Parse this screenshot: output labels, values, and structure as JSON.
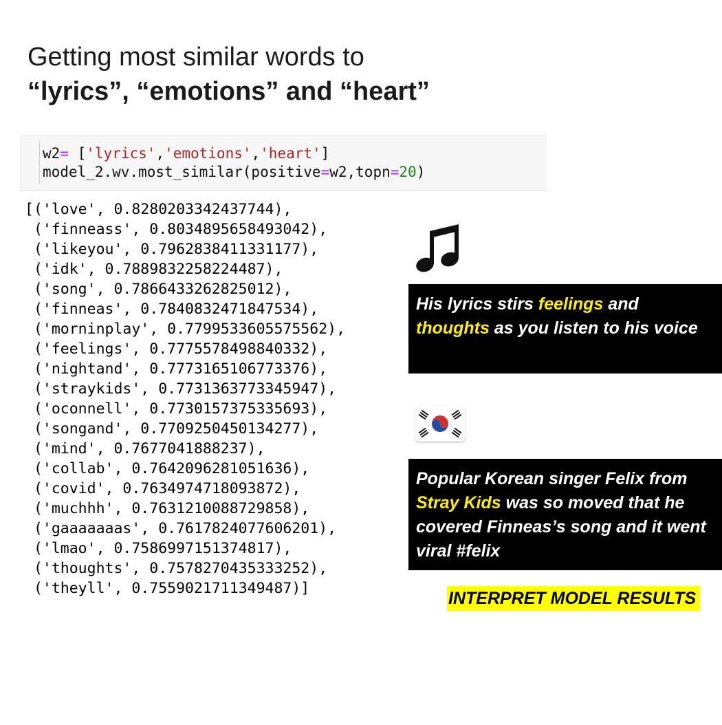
{
  "title": {
    "line1": "Getting most similar words to",
    "line2": "“lyrics”, “emotions” and “heart”"
  },
  "code": {
    "l1_var": "w2",
    "l1_eq": "=",
    "l1_open": " [",
    "l1_s1": "'lyrics'",
    "l1_c1": ",",
    "l1_s2": "'emotions'",
    "l1_c2": ",",
    "l1_s3": "'heart'",
    "l1_close": "]",
    "l2_a": "model_2.wv.most_similar(positive",
    "l2_eq1": "=",
    "l2_b": "w2,topn",
    "l2_eq2": "=",
    "l2_num": "20",
    "l2_close": ")"
  },
  "output": {
    "open": "[",
    "close": ")]",
    "results": [
      {
        "word": "love",
        "score": "0.8280203342437744"
      },
      {
        "word": "finneass",
        "score": "0.8034895658493042"
      },
      {
        "word": "likeyou",
        "score": "0.7962838411331177"
      },
      {
        "word": "idk",
        "score": "0.7889832258224487"
      },
      {
        "word": "song",
        "score": "0.7866433262825012"
      },
      {
        "word": "finneas",
        "score": "0.7840832471847534"
      },
      {
        "word": "morninplay",
        "score": "0.7799533605575562"
      },
      {
        "word": "feelings",
        "score": "0.7775578498840332"
      },
      {
        "word": "nightand",
        "score": "0.7773165106773376"
      },
      {
        "word": "straykids",
        "score": "0.7731363773345947"
      },
      {
        "word": "oconnell",
        "score": "0.7730157375335693"
      },
      {
        "word": "songand",
        "score": "0.7709250450134277"
      },
      {
        "word": "mind",
        "score": "0.7677041888237"
      },
      {
        "word": "collab",
        "score": "0.7642096281051636"
      },
      {
        "word": "covid",
        "score": "0.7634974718093872"
      },
      {
        "word": "muchhh",
        "score": "0.7631210088729858"
      },
      {
        "word": "gaaaaaaas",
        "score": "0.7617824077606201"
      },
      {
        "word": "lmao",
        "score": "0.7586997151374817"
      },
      {
        "word": "thoughts",
        "score": "0.7578270435333252"
      },
      {
        "word": "theyll",
        "score": "0.7559021711349487"
      }
    ]
  },
  "icons": {
    "music": "musical-notes-icon",
    "flag": "south-korea-flag-icon"
  },
  "box1": {
    "t1": "His lyrics stirs ",
    "h1": "feelings",
    "t2": " and",
    "h2": "thoughts",
    "t3": " as you listen to his voice"
  },
  "box2": {
    "t1": "Popular Korean singer Felix from",
    "h1": "Stray Kids",
    "t2": " was so moved that he covered Finneas’s song and it went viral #felix"
  },
  "interpret_label": "INTERPRET MODEL RESULTS",
  "colors": {
    "highlight_text": "#ffee00",
    "label_bg": "#ffff00",
    "box_bg": "#000000",
    "code_string": "#b22222",
    "code_operator": "#a020f0",
    "code_number": "#1a8a1a"
  }
}
